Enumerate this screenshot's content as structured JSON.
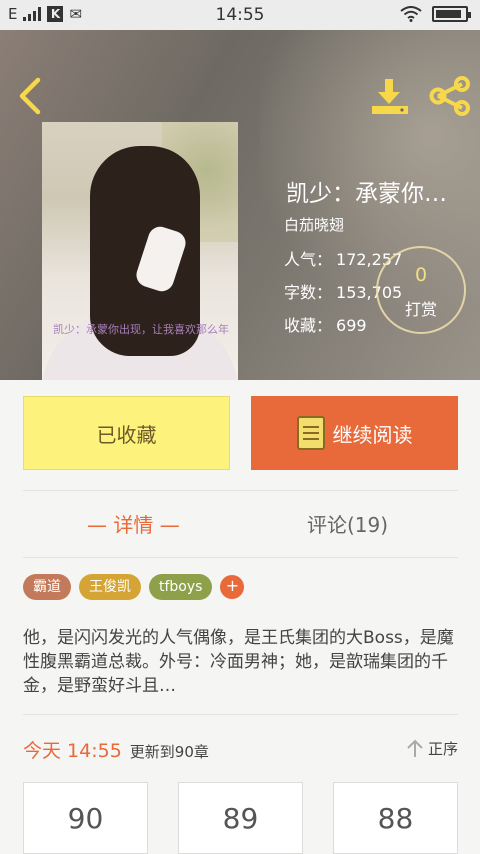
{
  "status_bar": {
    "carrier": "E",
    "time": "14:55",
    "battery_level": 0.9
  },
  "book": {
    "title": "凯少：承蒙你…",
    "author": "白茄晓翅",
    "popularity_label": "人气：",
    "popularity": "172,257",
    "words_label": "字数：",
    "words": "153,705",
    "collected_label": "收藏：",
    "collected": "699",
    "cover_text": "凯少：承蒙你出现，让我喜欢那么年",
    "reward_count": "0",
    "reward_label": "打赏"
  },
  "actions": {
    "favorited_label": "已收藏",
    "continue_label": "继续阅读"
  },
  "tabs": [
    {
      "label": "— 详情 —"
    },
    {
      "label": "评论(19)"
    }
  ],
  "tags": [
    {
      "label": "霸道",
      "color": "#c27a5b"
    },
    {
      "label": "王俊凯",
      "color": "#d4a534"
    },
    {
      "label": "tfboys",
      "color": "#8ea049"
    }
  ],
  "tag_add": "+",
  "description": "他，是闪闪发光的人气偶像，是王氏集团的大Boss，是魔性腹黑霸道总裁。外号：冷面男神；她，是歆瑞集团的千金，是野蛮好斗且…",
  "update": {
    "today": "今天 14:55",
    "info": "更新到90章"
  },
  "sort_label": "正序",
  "chapters": [
    "90",
    "89",
    "88"
  ],
  "colors": {
    "accent": "#e8693a",
    "favorite_bg": "#fdf37c",
    "icon_yellow": "#f6d84a"
  }
}
